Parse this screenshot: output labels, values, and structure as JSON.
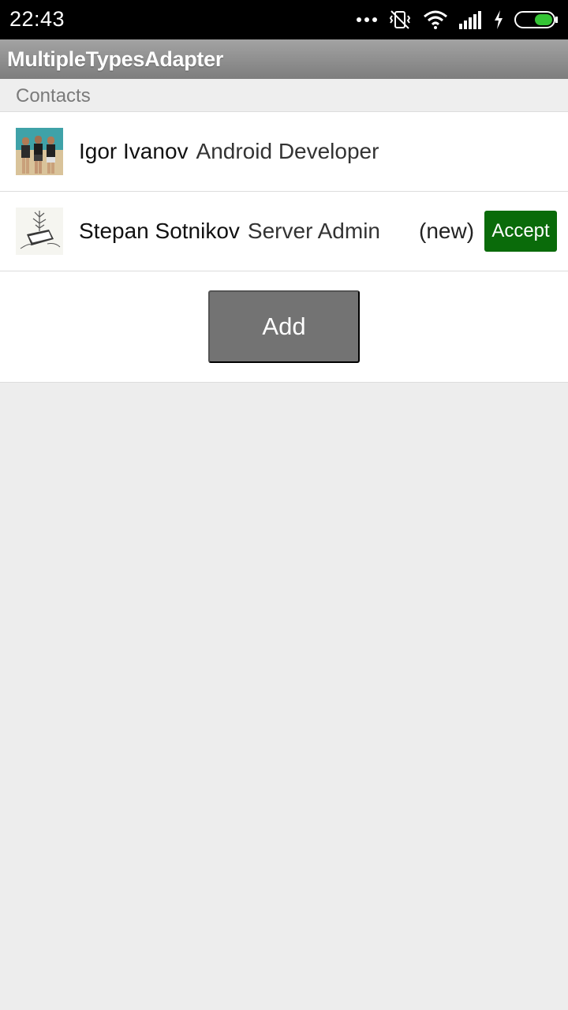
{
  "status_bar": {
    "time": "22:43",
    "icons": [
      "more-dots-icon",
      "vibrate-off-icon",
      "wifi-icon",
      "signal-icon",
      "charging-icon",
      "battery-icon"
    ],
    "battery_color": "#35c435"
  },
  "app_bar": {
    "title": "MultipleTypesAdapter"
  },
  "section": {
    "title": "Contacts"
  },
  "contacts": [
    {
      "name": "Igor Ivanov",
      "role": "Android Developer",
      "avatar": "photo-avatar"
    },
    {
      "name": "Stepan Sotnikov",
      "role": "Server Admin",
      "badge": "(new)",
      "action": "Accept",
      "avatar": "sketch-avatar",
      "action_color": "#0a6b0a"
    }
  ],
  "add_button": {
    "label": "Add",
    "color": "#737373"
  }
}
